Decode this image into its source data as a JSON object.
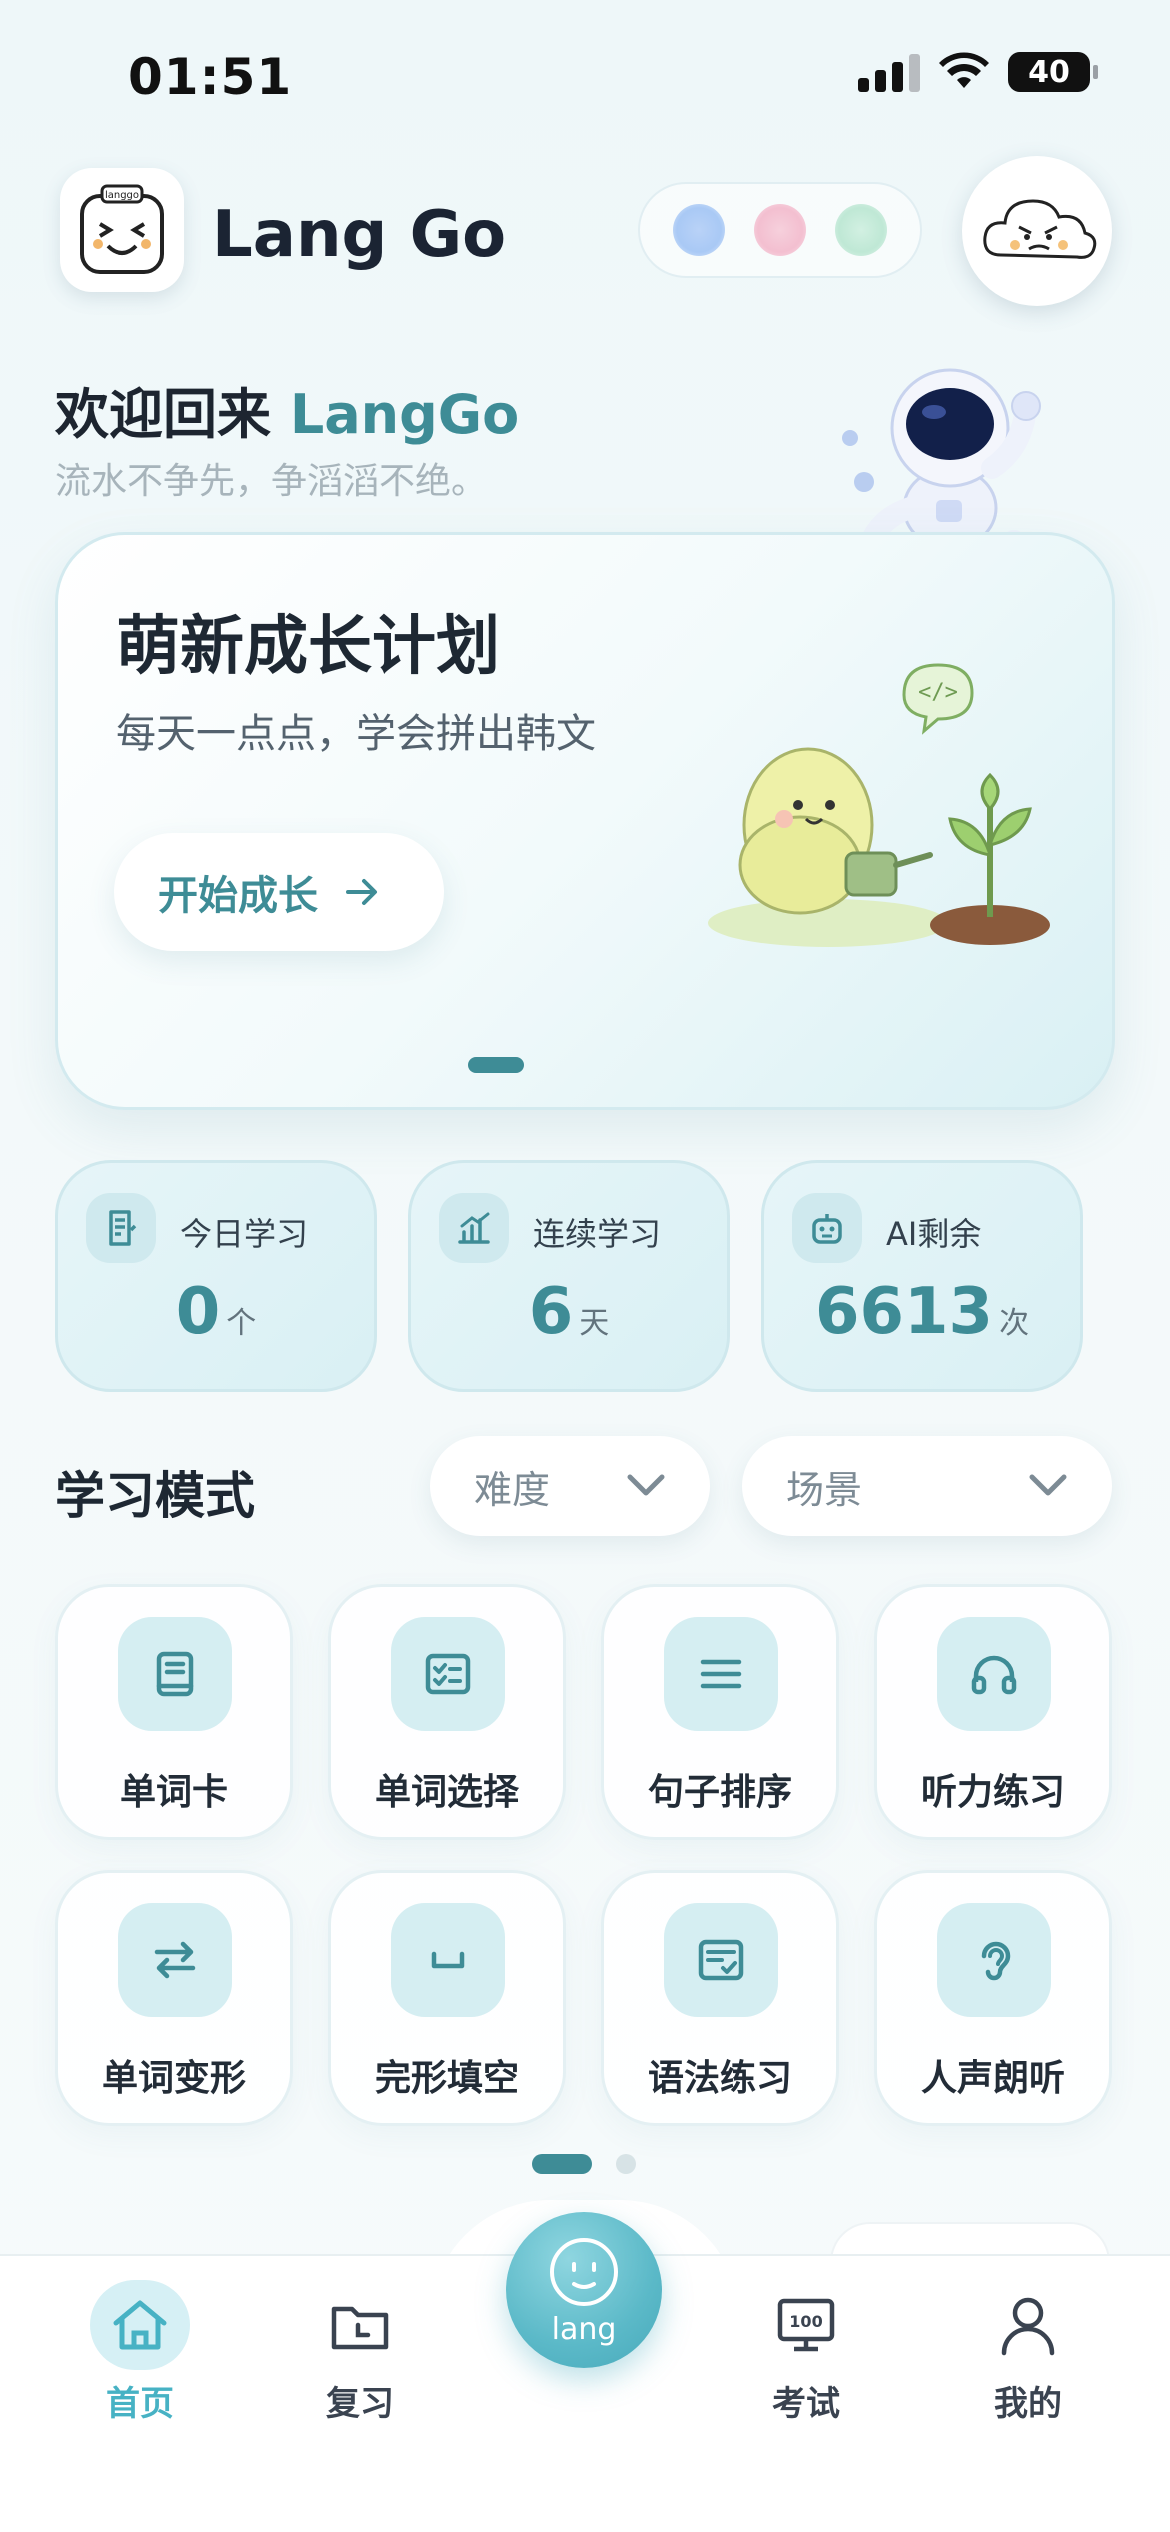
{
  "status_bar": {
    "time": "01:51",
    "battery": "40"
  },
  "header": {
    "app_title": "Lang Go",
    "logo_text": "langgo",
    "theme_colors": [
      "#a9c9f5",
      "#f3bfd0",
      "#bfe8d5"
    ]
  },
  "welcome": {
    "greeting": "欢迎回来 ",
    "username": "LangGo",
    "motto": "流水不争先，争滔滔不绝。"
  },
  "banner": {
    "title": "萌新成长计划",
    "subtitle": "每天一点点，学会拼出韩文",
    "button_label": "开始成长",
    "active_page": 1,
    "page_count": 1
  },
  "stats": [
    {
      "label": "今日学习",
      "value": "0",
      "unit": "个",
      "icon": "document-icon"
    },
    {
      "label": "连续学习",
      "value": "6",
      "unit": "天",
      "icon": "growth-chart-icon"
    },
    {
      "label": "AI剩余",
      "value": "6613",
      "unit": "次",
      "icon": "robot-icon"
    }
  ],
  "mode_section": {
    "title": "学习模式",
    "filters": [
      {
        "label": "难度",
        "icon": "chevron-down-icon"
      },
      {
        "label": "场景",
        "icon": "chevron-down-icon"
      }
    ]
  },
  "modes": [
    {
      "label": "单词卡",
      "icon": "book-icon"
    },
    {
      "label": "单词选择",
      "icon": "checklist-icon"
    },
    {
      "label": "句子排序",
      "icon": "lines-icon"
    },
    {
      "label": "听力练习",
      "icon": "headphones-icon"
    },
    {
      "label": "单词变形",
      "icon": "swap-arrows-icon"
    },
    {
      "label": "完形填空",
      "icon": "blank-icon"
    },
    {
      "label": "语法练习",
      "icon": "grammar-icon"
    },
    {
      "label": "人声朗听",
      "icon": "ear-icon"
    }
  ],
  "modes_pager": {
    "active_page": 1,
    "page_count": 2
  },
  "tabbar": {
    "items": [
      {
        "label": "首页",
        "icon": "home-icon",
        "active": true
      },
      {
        "label": "复习",
        "icon": "folder-clock-icon",
        "active": false
      },
      {
        "label": "考试",
        "icon": "exam-100-icon",
        "active": false,
        "icon_text": "100"
      },
      {
        "label": "我的",
        "icon": "user-icon",
        "active": false
      }
    ],
    "center": {
      "label": "lang",
      "icon": "smiley-icon"
    }
  },
  "colors": {
    "accent": "#3e8c96",
    "tab_active": "#47b2c4",
    "tile_icon_bg": "#d5eef2"
  }
}
